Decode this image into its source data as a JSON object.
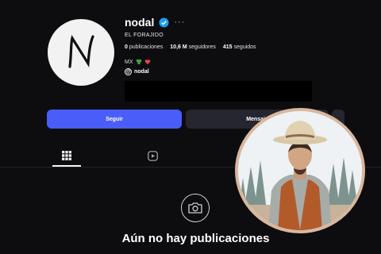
{
  "profile": {
    "username": "nodal",
    "more_label": "···",
    "full_name": "EL FORAJIDO",
    "stats": {
      "posts_value": "0",
      "posts_label": "publicaciones",
      "followers_value": "10,6 M",
      "followers_label": "seguidores",
      "following_value": "415",
      "following_label": "seguidos"
    },
    "bio_text": "MX",
    "threads_handle": "nodal"
  },
  "actions": {
    "follow_label": "Seguir",
    "message_label": "Mensaje"
  },
  "tabs": [
    {
      "icon": "grid-icon",
      "active": true
    },
    {
      "icon": "reels-icon",
      "active": false
    }
  ],
  "empty_state": {
    "icon": "camera-icon",
    "text": "Aún no hay publicaciones"
  },
  "colors": {
    "background": "#0d0d10",
    "follow_button": "#4a5df9",
    "secondary_button": "#262630",
    "verified": "#1d9bf0",
    "overlay_ring": "#d9b79e"
  }
}
